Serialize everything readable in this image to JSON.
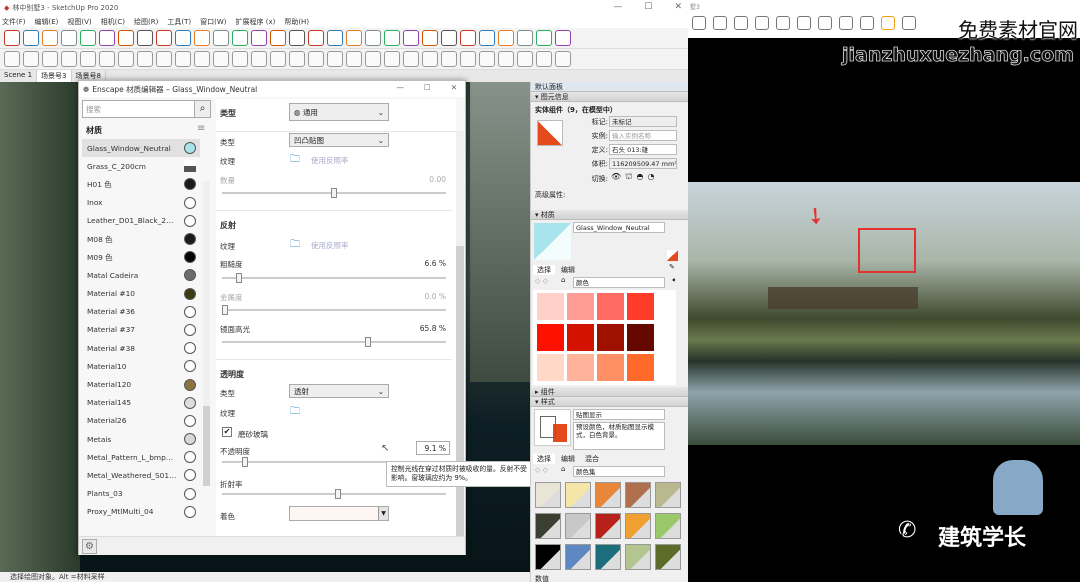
{
  "app": {
    "title": "林中别墅3 - SketchUp Pro 2020",
    "menu": [
      "文件(F)",
      "编辑(E)",
      "视图(V)",
      "相机(C)",
      "绘图(R)",
      "工具(T)",
      "窗口(W)",
      "扩展程序 (x)",
      "帮助(H)"
    ],
    "window_controls": [
      "—",
      "☐",
      "✕"
    ],
    "toolbar1_icons": [
      "select-icon",
      "eraser-icon",
      "pencil-icon",
      "arc-icon",
      "shape-icon",
      "push-pull-icon",
      "follow-me-icon",
      "move-icon",
      "rotate-icon",
      "scale-icon",
      "tape-icon",
      "text-icon",
      "paint-bucket-icon",
      "orbit-icon",
      "pan-icon",
      "zoom-icon",
      "zoom-extents-icon",
      "warehouse-icon",
      "extension-icon",
      "layout-icon",
      "ruby-icon",
      "user-icon",
      "component-icon",
      "sandbox-icon",
      "style-icon",
      "plugin-a-icon",
      "plugin-b-icon",
      "plugin-c-icon",
      "plugin-d-icon",
      "plugin-e-icon"
    ],
    "toolbar2_icons": [
      "circle-icon",
      "teapot-icon",
      "cloud-icon",
      "refresh-icon",
      "section-icon",
      "section-fill-icon",
      "window-icon",
      "window2-icon",
      "image-icon",
      "lock-icon",
      "light-icon",
      "spot-icon",
      "ring-icon",
      "cone-icon",
      "umbrella-icon",
      "sun-icon",
      "dome-icon",
      "ball-icon",
      "solid-union-icon",
      "solid-sub-icon",
      "box1-icon",
      "box2-icon",
      "box3-icon",
      "box4-icon",
      "box5-icon",
      "hand-icon",
      "sandbox1-icon",
      "sandbox2-icon",
      "sandbox3-icon",
      "line-icon"
    ],
    "scenes": [
      "Scene 1",
      "场景号3",
      "场景号8"
    ],
    "status": "选择绘图对象。Alt =材料采样"
  },
  "enscape": {
    "title": "Enscape 材质编辑器 – Glass_Window_Neutral",
    "search_placeholder": "搜索",
    "materials_header": "材质",
    "materials": [
      {
        "name": "Glass_Window_Neutral",
        "color": "#a9e3ec",
        "selected": true
      },
      {
        "name": "Grass_C_200cm",
        "color": "grass"
      },
      {
        "name": "H01 色",
        "color": "#1a1a1a"
      },
      {
        "name": "Inox",
        "color": "#ffffff"
      },
      {
        "name": "Leather_D01_Black_2…",
        "color": "#ffffff"
      },
      {
        "name": "M08 色",
        "color": "#1a1a1a"
      },
      {
        "name": "M09 色",
        "color": "#050505"
      },
      {
        "name": "Matal Cadeira",
        "color": "#6d6d6d"
      },
      {
        "name": "Material #10",
        "color": "#3c3b12"
      },
      {
        "name": "Material #36",
        "color": "#ffffff"
      },
      {
        "name": "Material #37",
        "color": "#ffffff"
      },
      {
        "name": "Material #38",
        "color": "#ffffff"
      },
      {
        "name": "Material10",
        "color": "#ffffff"
      },
      {
        "name": "Material120",
        "color": "#8c7440"
      },
      {
        "name": "Material145",
        "color": "#dedede"
      },
      {
        "name": "Material26",
        "color": "#ffffff"
      },
      {
        "name": "Metais",
        "color": "#d8d8d8"
      },
      {
        "name": "Metal_Pattern_L_bmp…",
        "color": "#ffffff"
      },
      {
        "name": "Metal_Weathered_S01…",
        "color": "#ffffff"
      },
      {
        "name": "Plants_03",
        "color": "#ffffff"
      },
      {
        "name": "Proxy_MtlMulti_04",
        "color": "#ffffff"
      }
    ],
    "type_label": "类型",
    "type_value": "通用",
    "bump": {
      "type_label": "类型",
      "type_value": "凹凸贴图",
      "texture_label": "纹理",
      "texture_link": "使用反照率",
      "amount_label": "数量",
      "amount_value": "0.00",
      "amount_fraction": 0.5
    },
    "reflection": {
      "title": "反射",
      "texture_label": "纹理",
      "texture_link": "使用反照率",
      "roughness_label": "粗糙度",
      "roughness_value": "6.6 %",
      "roughness": 6.6,
      "metallic_label": "金属度",
      "metallic_value": "0.0 %",
      "metallic": 0,
      "specular_label": "镜面高光",
      "specular_value": "65.8 %",
      "specular": 65.8
    },
    "transparency": {
      "title": "透明度",
      "type_label": "类型",
      "type_value": "透射",
      "texture_label": "纹理",
      "frosted_label": "磨砂玻璃",
      "frosted_checked": true,
      "opacity_label": "不透明度",
      "opacity_value": "9.1 %",
      "opacity": 9.1,
      "ior_label": "折射率",
      "ior_fraction": 0.52,
      "tint_label": "着色",
      "tint_color": "#fdf6f2"
    },
    "tooltip": "控制光线在穿过材质时被吸收的量。反射不受影响。窗玻璃应约为 9%。"
  },
  "tray": {
    "title": "默认面板",
    "entity": {
      "header": "图元信息",
      "summary": "实体组件（9，在模型中）",
      "tag_label": "标记:",
      "tag_value": "未标记",
      "instance_label": "实例:",
      "instance_placeholder": "输入实例名称",
      "definition_label": "定义:",
      "definition_value": "石头 013:雄",
      "volume_label": "体积:",
      "volume_value": "116209509.47 mm³",
      "toggle_label": "切换:",
      "advanced_label": "高级属性:"
    },
    "materials": {
      "header": "材质",
      "name": "Glass_Window_Neutral",
      "tabs": [
        "选择",
        "编辑"
      ],
      "library": "颜色",
      "swatches": [
        "#ffcfc8",
        "#ff9d94",
        "#ff6b60",
        "#ff3b2a",
        "#ff1100",
        "#d41200",
        "#9e1000",
        "#650800",
        "#ffd8c8",
        "#ffb39a",
        "#ff9066",
        "#ff6a2a"
      ]
    },
    "collapsed": "组件",
    "styles": {
      "header": "样式",
      "name": "贴图显示",
      "description": "预设颜色，材质贴图显示模式，白色背景。",
      "tabs": [
        "选择",
        "编辑",
        "混合"
      ],
      "library": "颜色集",
      "thumbs": [
        "#e8e4d6",
        "#f4e6a6",
        "#e8863a",
        "#b0704e",
        "#b9b88f",
        "#3a3f32",
        "#c8c8c8",
        "#b8201a",
        "#f0a030",
        "#9ac86a",
        "#000000",
        "#5d88c2",
        "#1c6e7c",
        "#b4c690",
        "#5e6c2a"
      ]
    },
    "bottom_label": "数值"
  },
  "render": {
    "title": "墅3",
    "watermark_cn": "免费素材官网",
    "watermark_url": "jianzhuxuezhang.com",
    "brand": "建筑学长",
    "highlight_color": "#e53030"
  }
}
